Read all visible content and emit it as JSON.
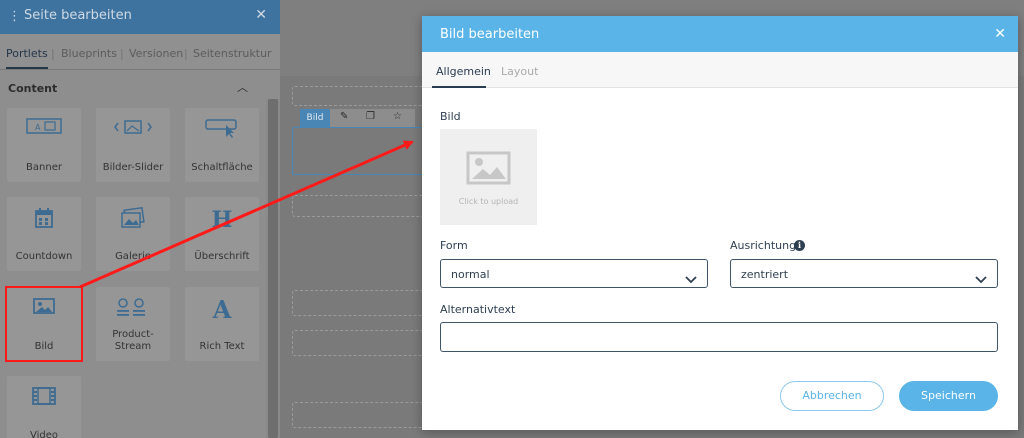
{
  "sidebar": {
    "title": "Seite bearbeiten",
    "tabs": [
      "Portlets",
      "Blueprints",
      "Versionen",
      "Seitenstruktur"
    ],
    "section_label": "Content",
    "tiles": [
      {
        "label": "Banner",
        "icon": "banner-icon"
      },
      {
        "label": "Bilder-Slider",
        "icon": "image-slider-icon"
      },
      {
        "label": "Schaltfläche",
        "icon": "button-cursor-icon"
      },
      {
        "label": "Countdown",
        "icon": "calendar-icon"
      },
      {
        "label": "Galerie",
        "icon": "gallery-icon"
      },
      {
        "label": "Überschrift",
        "icon": "heading-icon"
      },
      {
        "label": "Bild",
        "icon": "image-icon"
      },
      {
        "label": "Product-Stream",
        "icon": "product-stream-icon"
      },
      {
        "label": "Rich Text",
        "icon": "rich-text-icon"
      },
      {
        "label": "Video",
        "icon": "video-icon"
      }
    ]
  },
  "builder": {
    "portlet_chip": "Bild"
  },
  "modal": {
    "title": "Bild bearbeiten",
    "tabs": [
      "Allgemein",
      "Layout"
    ],
    "image_label": "Bild",
    "upload_hint": "Click to upload",
    "form_label": "Form",
    "form_value": "normal",
    "alignment_label": "Ausrichtung",
    "alignment_value": "zentriert",
    "alt_label": "Alternativtext",
    "alt_value": "",
    "cancel_label": "Abbrechen",
    "save_label": "Speichern"
  },
  "colors": {
    "modal_header": "#5ab4e8",
    "sidebar_header": "#3e73a0",
    "highlight": "#ff1a1a",
    "accent": "#5ab4e8"
  }
}
